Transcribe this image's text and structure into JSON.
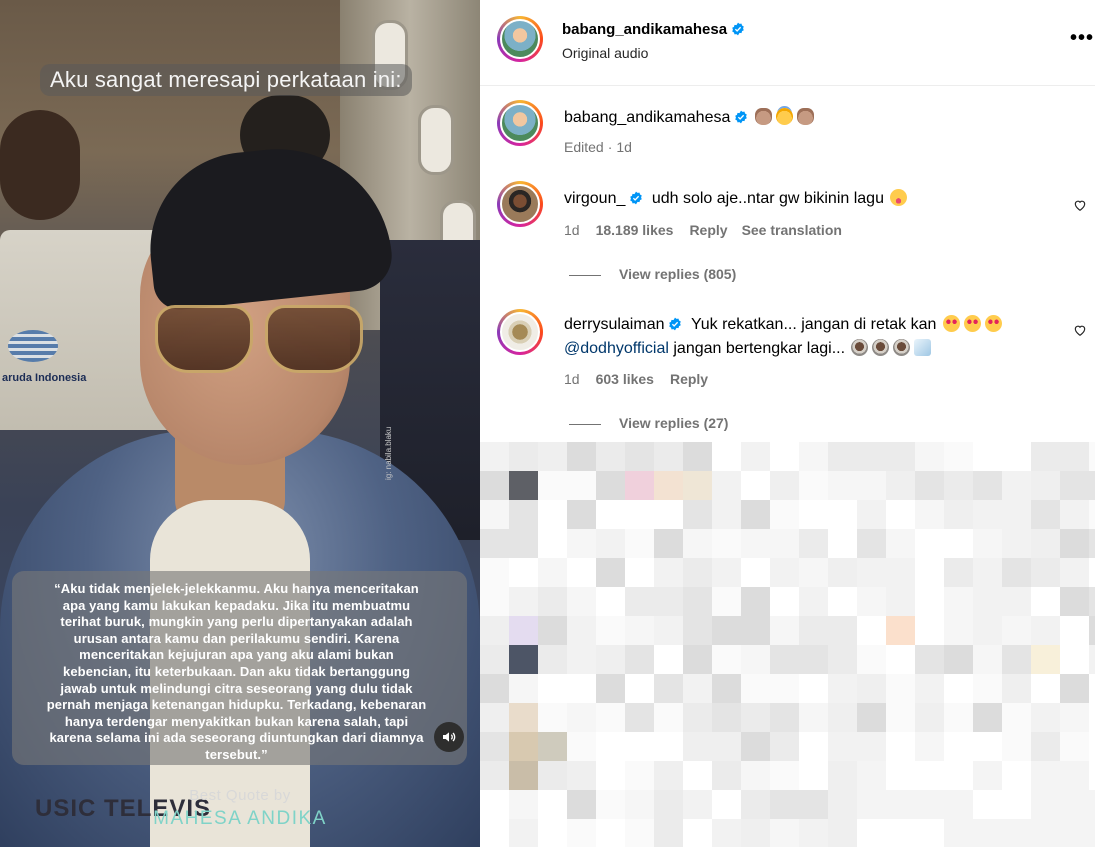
{
  "media": {
    "caption": "Aku sangat meresapi perkataan ini:",
    "quote": "“Aku tidak menjelek-jelekkanmu. Aku hanya menceritakan apa yang kamu lakukan kepadaku. Jika itu membuatmu terihat buruk, mungkin yang perlu dipertanyakan adalah urusan antara  kamu dan perilakumu sendiri. Karena menceritakan kejujuran apa yang aku alami bukan kebencian, itu keterbukaan. Dan aku tidak bertanggung jawab untuk melindungi citra seseorang yang dulu tidak pernah menjaga ketenangan hidupku. Terkadang, kebenaran hanya terdengar menyakitkan bukan karena salah, tapi karena selama ini ada seseorang diuntungkan dari diamnya tersebut.”",
    "best_quote_label": "Best Quote by",
    "author": "MAHESA ANDIKA",
    "seat_text": "aruda Indonesia",
    "shirt_text": "USIC TELEVIS",
    "watermark": "ig: nabila.blaku",
    "audio_icon": "speaker-icon"
  },
  "header": {
    "username": "babang_andikamahesa",
    "subtitle": "Original audio",
    "more_icon": "more-options-icon",
    "more_label": "•••"
  },
  "caption_post": {
    "username": "babang_andikamahesa",
    "emojis": [
      "pray",
      "halo",
      "pray"
    ],
    "edited": "Edited",
    "time": "1d"
  },
  "comments": [
    {
      "username": "virgoun_",
      "text": "udh solo aje..ntar gw bikinin lagu",
      "emoji": "tongue",
      "time": "1d",
      "likes": "18.189 likes",
      "reply": "Reply",
      "translation": "See translation",
      "view_replies": "View replies (805)"
    },
    {
      "username": "derrysulaiman",
      "text": "Yuk rekatkan... jangan di retak kan",
      "mention": "@dodhyofficial",
      "text2": "jangan bertengkar lagi...",
      "time": "1d",
      "likes": "603 likes",
      "reply": "Reply",
      "view_replies": "View replies (27)"
    }
  ],
  "colors": {
    "verified": "#0095f6",
    "meta": "#737373",
    "mention": "#00376b"
  }
}
